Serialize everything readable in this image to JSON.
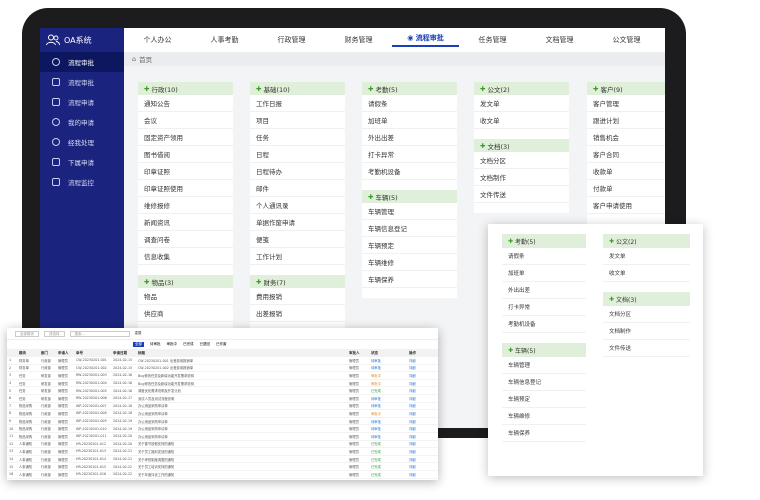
{
  "app": {
    "title": "OA系统"
  },
  "sidebar": {
    "items": [
      {
        "label": "流程审批"
      },
      {
        "label": "流程审批"
      },
      {
        "label": "流程申请"
      },
      {
        "label": "我的申请"
      },
      {
        "label": "经我处理"
      },
      {
        "label": "下属申请"
      },
      {
        "label": "流程监控"
      }
    ]
  },
  "topnav": {
    "items": [
      "个人办公",
      "人事考勤",
      "行政管理",
      "财务管理",
      "流程审批",
      "任务管理",
      "文档管理",
      "公文管理"
    ]
  },
  "breadcrumb": {
    "label": "首页"
  },
  "columns": [
    {
      "cards": [
        {
          "title": "行政(10)",
          "items": [
            "通知公告",
            "会议",
            "固定资产领用",
            "图书借阅",
            "印章证照",
            "印章证照使用",
            "维修报修",
            "新闻资讯",
            "调查问卷",
            "信息收集"
          ]
        },
        {
          "title": "物品(3)",
          "items": [
            "物品",
            "供应商"
          ]
        }
      ]
    },
    {
      "cards": [
        {
          "title": "基础(10)",
          "items": [
            "工作日报",
            "项目",
            "任务",
            "日程",
            "日程待办",
            "邮件",
            "个人通讯录",
            "单据作废申请",
            "便笺",
            "工作计划"
          ]
        },
        {
          "title": "财务(7)",
          "items": [
            "费用报销",
            "出差报销"
          ]
        }
      ]
    },
    {
      "cards": [
        {
          "title": "考勤(5)",
          "items": [
            "请假条",
            "加班单",
            "外出出差",
            "打卡异常",
            "考勤机设备"
          ]
        },
        {
          "title": "车辆(5)",
          "items": [
            "车辆管理",
            "车辆信息登记",
            "车辆预定",
            "车辆维修",
            "车辆保养"
          ]
        }
      ]
    },
    {
      "cards": [
        {
          "title": "公文(2)",
          "items": [
            "发文单",
            "收文单"
          ]
        },
        {
          "title": "文档(3)",
          "items": [
            "文档分区",
            "文档制作",
            "文件传送"
          ]
        }
      ]
    },
    {
      "cards": [
        {
          "title": "客户(9)",
          "items": [
            "客户管理",
            "跟进计划",
            "销售机会",
            "客户合同",
            "收款单",
            "付款单",
            "客户申请使用"
          ]
        }
      ]
    }
  ],
  "overlay_panel": {
    "left": [
      {
        "title": "考勤(5)",
        "items": [
          "请假条",
          "加班单",
          "外出出差",
          "打卡异常",
          "考勤机设备"
        ]
      },
      {
        "title": "车辆(5)",
        "items": [
          "车辆管理",
          "车辆信息登记",
          "车辆预定",
          "车辆维修",
          "车辆保养"
        ]
      }
    ],
    "right": [
      {
        "title": "公文(2)",
        "items": [
          "发文单",
          "收文单"
        ]
      },
      {
        "title": "文档(3)",
        "items": [
          "文档分区",
          "文档制作",
          "文件传送"
        ]
      }
    ]
  },
  "table_panel": {
    "toolbar": {
      "filter1": "全部模块",
      "filter2": "请选择",
      "search_placeholder": "搜索…",
      "reset": "重置"
    },
    "tabs": [
      "全部",
      "待审批",
      "审批中",
      "已完成",
      "已退回",
      "已作废"
    ],
    "headers": [
      "",
      "模块",
      "部门",
      "申请人",
      "单号",
      "申请日期",
      "标题",
      "审批人",
      "状态",
      "操作"
    ],
    "rows": [
      [
        "1",
        "财务单",
        "行政部",
        "管理员",
        "CW-20230201-001",
        "2024-02-15",
        "CW-20230201-001 出差费用报销单",
        "管理员",
        "待审批",
        "详细"
      ],
      [
        "2",
        "财务单",
        "行政部",
        "管理员",
        "CW-20230201-002",
        "2024-02-15",
        "CW-20230201-002 出差费用报销单",
        "管理员",
        "待审批",
        "详细"
      ],
      [
        "3",
        "任务",
        "研发部",
        "管理员",
        "RW-20230201-003",
        "2024-02-16",
        "Bug修改任务及新增功能开发需求说明",
        "管理员",
        "审批中",
        "详细"
      ],
      [
        "4",
        "任务",
        "研发部",
        "管理员",
        "RW-20230201-004",
        "2024-02-16",
        "Bug修改任务及新增功能开发需求说明",
        "管理员",
        "审批中",
        "详细"
      ],
      [
        "5",
        "任务",
        "研发部",
        "管理员",
        "RW-20230201-005",
        "2024-02-16",
        "调度优化需求说明及开发计划",
        "管理员",
        "已完成",
        "详细"
      ],
      [
        "6",
        "任务",
        "研发部",
        "管理员",
        "RW-20230201-006",
        "2024-02-17",
        "测试人员及测试流程说明",
        "管理员",
        "待审批",
        "详细"
      ],
      [
        "7",
        "物品采购",
        "行政部",
        "管理员",
        "WP-20230201-007",
        "2024-02-18",
        "办公用品采购申请单",
        "管理员",
        "待审批",
        "详细"
      ],
      [
        "8",
        "物品采购",
        "行政部",
        "管理员",
        "WP-20230201-008",
        "2024-02-18",
        "办公用品采购申请单",
        "管理员",
        "审批中",
        "详细"
      ],
      [
        "9",
        "物品采购",
        "行政部",
        "管理员",
        "WP-20230201-009",
        "2024-02-19",
        "办公用品采购申请单",
        "管理员",
        "待审批",
        "详细"
      ],
      [
        "10",
        "物品采购",
        "行政部",
        "管理员",
        "WP-20230201-010",
        "2024-02-19",
        "办公用品采购申请单",
        "管理员",
        "待审批",
        "详细"
      ],
      [
        "11",
        "物品采购",
        "行政部",
        "管理员",
        "WP-20230201-011",
        "2024-02-20",
        "办公用品采购申请单",
        "管理员",
        "待审批",
        "详细"
      ],
      [
        "12",
        "人事通知",
        "行政部",
        "管理员",
        "HR-20230201-012",
        "2024-02-20",
        "关于春节放假安排的通知",
        "管理员",
        "已完成",
        "详细"
      ],
      [
        "13",
        "人事通知",
        "行政部",
        "管理员",
        "HR-20230201-013",
        "2024-02-21",
        "关于员工福利发放的通知",
        "管理员",
        "已完成",
        "详细"
      ],
      [
        "14",
        "人事通知",
        "行政部",
        "管理员",
        "HR-20230201-014",
        "2024-02-21",
        "关于考勤制度调整的通知",
        "管理员",
        "已完成",
        "详细"
      ],
      [
        "15",
        "人事通知",
        "行政部",
        "管理员",
        "HR-20230201-015",
        "2024-02-22",
        "关于员工培训安排的通知",
        "管理员",
        "已完成",
        "详细"
      ],
      [
        "16",
        "人事通知",
        "行政部",
        "管理员",
        "HR-20230201-016",
        "2024-02-22",
        "关于年度评优工作的通知",
        "管理员",
        "已完成",
        "详细"
      ],
      [
        "17",
        "人事通知",
        "行政部",
        "管理员",
        "HR-20230201-017",
        "2024-02-23",
        "关于办公环境整改的通知",
        "管理员",
        "已完成",
        "详细"
      ],
      [
        "18",
        "人事通知",
        "行政部",
        "管理员",
        "HR-20230201-018",
        "2024-02-23",
        "关于安全生产检查的通知",
        "管理员",
        "已完成",
        "详细"
      ]
    ]
  }
}
